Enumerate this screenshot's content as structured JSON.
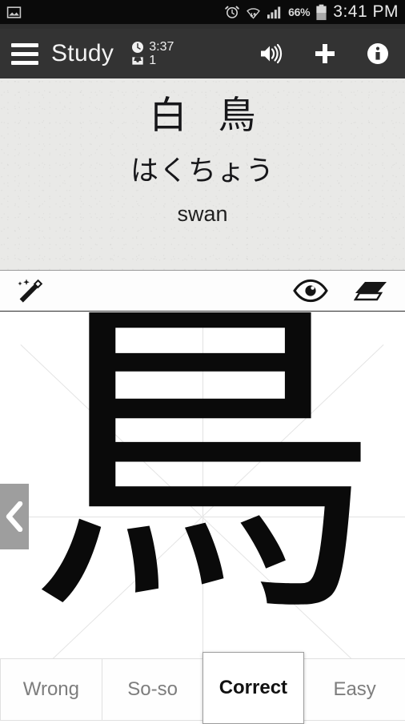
{
  "status_bar": {
    "left_icons": [
      "image-icon"
    ],
    "right_icons": [
      "alarm-icon",
      "wifi-icon",
      "signal-icon",
      "battery-icon"
    ],
    "battery_percent": "66%",
    "time": "3:41 PM"
  },
  "app_bar": {
    "menu_icon": "hamburger-menu-icon",
    "title": "Study",
    "timer_icon": "clock-icon",
    "timer_value": "3:37",
    "queue_icon": "inbox-icon",
    "queue_value": "1",
    "actions": [
      {
        "name": "speaker-button",
        "icon": "speaker-icon"
      },
      {
        "name": "add-button",
        "icon": "plus-icon"
      },
      {
        "name": "info-button",
        "icon": "info-icon"
      }
    ]
  },
  "card": {
    "kanji": "白 鳥",
    "reading": "はくちょう",
    "meaning": "swan"
  },
  "tool_bar": {
    "wand_icon": "magic-wand-icon",
    "reveal_icon": "eye-icon",
    "erase_icon": "eraser-icon"
  },
  "canvas": {
    "drawn_character": "鳥",
    "grid": "guide-grid-visible"
  },
  "peek_tab": {
    "icon": "chevron-left-icon"
  },
  "answers": {
    "buttons": [
      {
        "label": "Wrong",
        "selected": false
      },
      {
        "label": "So-so",
        "selected": false
      },
      {
        "label": "Correct",
        "selected": true
      },
      {
        "label": "Easy",
        "selected": false
      }
    ]
  },
  "colors": {
    "status_bar_bg": "#0a0a0a",
    "app_bar_bg": "#333333",
    "card_bg": "#e9e9e7",
    "canvas_bg": "#ffffff",
    "peek_tab_bg": "#9e9e9e",
    "selected_text": "#111111",
    "muted_text": "#7d7d7d"
  }
}
